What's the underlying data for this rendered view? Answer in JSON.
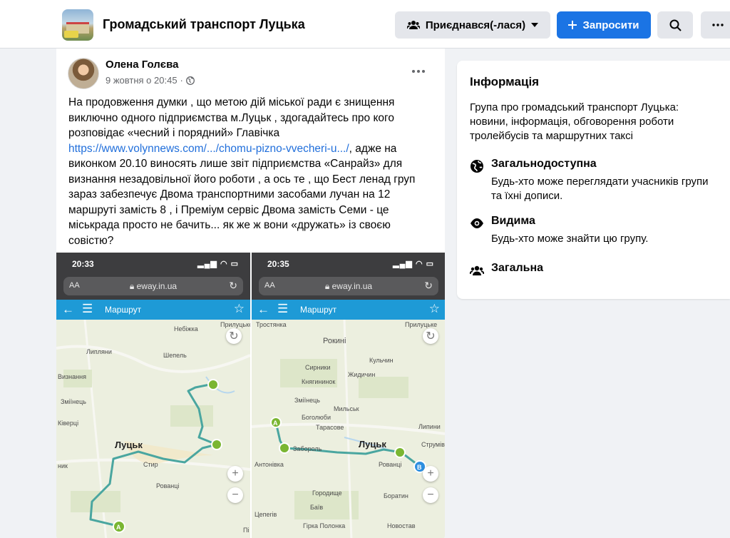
{
  "header": {
    "group_name": "Громадський транспорт Луцька",
    "joined_label": "Приєднався(-лася)",
    "invite_label": "Запросити"
  },
  "post": {
    "author": "Олена Голєва",
    "timestamp": "9 жовтня о 20:45",
    "text_1": "На продовження думки , що метою дій міської ради є знищення виключно одного підприємства м.Луцьк  , здогадайтесь про кого розповідає «чесний і порядний» Главічка ",
    "link": "https://www.volynnews.com/.../chomu-pizno-vvecheri-u.../",
    "text_2": ", адже на виконком 20.10 виносять лише звіт підприємства «Санрайз» для визнання незадовільної його роботи , а ось те , що Бест ленад груп зараз забезпечує Двома транспортними засобами лучан на 12 маршруті замість 8 , і Преміум сервіс Двома замість Семи - це міськрада просто не бачить... як же ж вони «дружать» із своєю совістю?"
  },
  "screenshots": [
    {
      "time": "20:33",
      "url": "eway.in.ua",
      "aa": "AA",
      "appbar_title": "Маршрут",
      "labels": [
        "Небіжка",
        "Прилуцьке",
        "Липляни",
        "Шепель",
        "Визнання",
        "Зміїнець",
        "Ківерці",
        "Луцьк",
        "Стир",
        "Рованці",
        "ник",
        "Пі"
      ],
      "route_start_marker": "A"
    },
    {
      "time": "20:35",
      "url": "eway.in.ua",
      "aa": "AA",
      "appbar_title": "Маршрут",
      "labels": [
        "Тростянка",
        "Прилуцьке",
        "Рокині",
        "Кульчин",
        "Сирники",
        "Жидичин",
        "Княгининок",
        "Мильськ",
        "Зміїнець",
        "Боголюби",
        "Тарасове",
        "Забороль",
        "Луцьк",
        "Антонівка",
        "Рованці",
        "Струмівка",
        "Липини",
        "Городище",
        "Боратин",
        "Баїв",
        "Цепerів",
        "Гірка Полонка",
        "Новостав"
      ],
      "route_start_marker": "A",
      "route_end_marker": "B"
    }
  ],
  "info": {
    "title": "Інформація",
    "description": "Група про громадський транспорт Луцька: новини, інформація, обговорення роботи тролейбусів та маршрутних таксі",
    "public_title": "Загальнодоступна",
    "public_desc": "Будь-хто може переглядати учасників групи та їхні дописи.",
    "visible_title": "Видима",
    "visible_desc": "Будь-хто може знайти цю групу.",
    "general_title": "Загальна"
  },
  "colors": {
    "accent": "#1b74e4",
    "link": "#216fdb",
    "route": "#4aa6a0"
  }
}
